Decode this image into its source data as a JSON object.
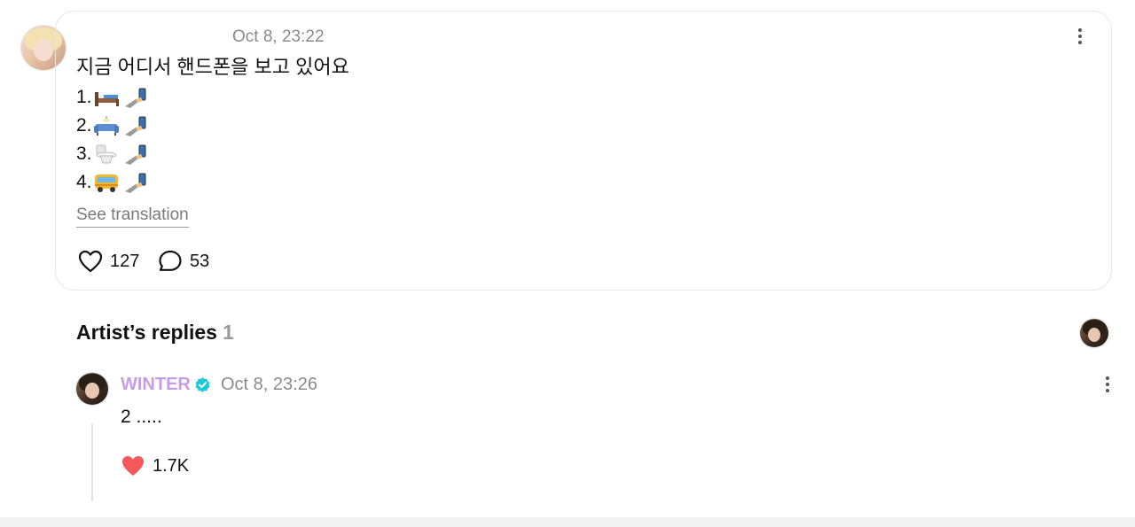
{
  "post": {
    "timestamp": "Oct 8, 23:22",
    "text": "지금 어디서 핸드폰을 보고 있어요",
    "options": [
      {
        "number": "1.",
        "icons": [
          "bed-icon",
          "hand-holding-phone-icon"
        ]
      },
      {
        "number": "2.",
        "icons": [
          "couch-icon",
          "hand-holding-phone-icon"
        ]
      },
      {
        "number": "3.",
        "icons": [
          "toilet-icon",
          "hand-holding-phone-icon"
        ]
      },
      {
        "number": "4.",
        "icons": [
          "bus-icon",
          "hand-holding-phone-icon"
        ]
      }
    ],
    "see_translation": "See translation",
    "likes": "127",
    "comments": "53"
  },
  "replies_section": {
    "title": "Artist’s replies",
    "count": "1"
  },
  "reply": {
    "author": "WINTER",
    "timestamp": "Oct 8, 23:26",
    "text": "2 .....",
    "likes": "1.7K"
  },
  "colors": {
    "artist_name": "#c89be6",
    "verified_badge": "#1fc8d9",
    "liked_heart": "#f4585a",
    "border": "#e6e6e6"
  }
}
